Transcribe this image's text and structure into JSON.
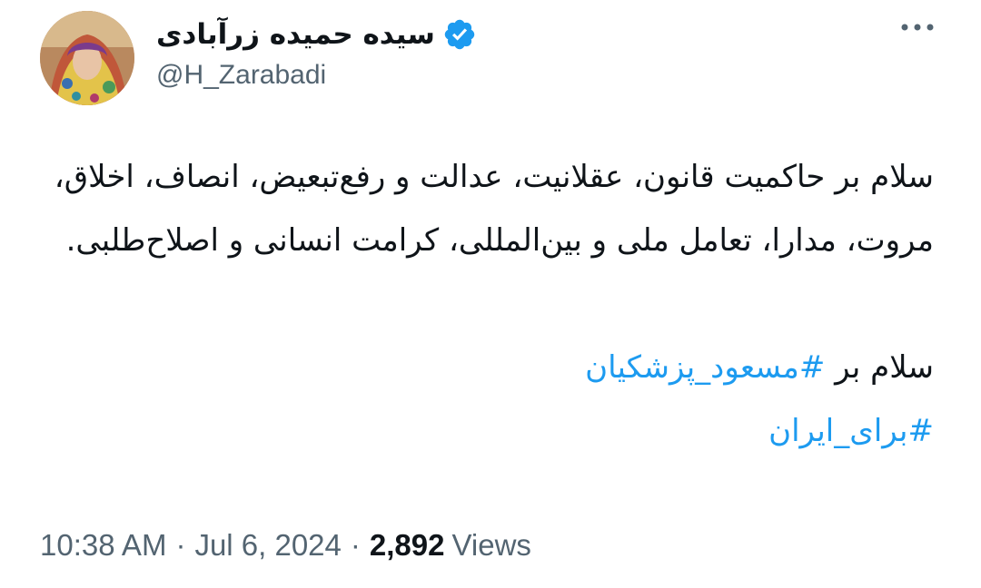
{
  "tweet": {
    "author": {
      "display_name": "سیده حمیده زرآبادی",
      "handle": "@H_Zarabadi",
      "verified": true
    },
    "body": {
      "paragraph_1": "سلام بر حاکمیت قانون، عقلانیت، عدالت و رفع‌تبعیض، انصاف، اخلاق، مروت، مدارا، تعامل ملی و بین‌المللی، کرامت انسانی و اصلاح‌طلبی.",
      "line_2_text": "سلام بر",
      "hashtag_1": "#مسعود_پزشکیان",
      "hashtag_2": "#برای_ایران"
    },
    "meta": {
      "time": "10:38 AM",
      "separator": "·",
      "date": "Jul 6, 2024",
      "views_count": "2,892",
      "views_label": "Views"
    }
  },
  "colors": {
    "text": "#0f1419",
    "secondary": "#536471",
    "accent": "#1d9bf0"
  },
  "icons": {
    "verified": "verified-badge-icon",
    "more": "more-options-icon"
  }
}
